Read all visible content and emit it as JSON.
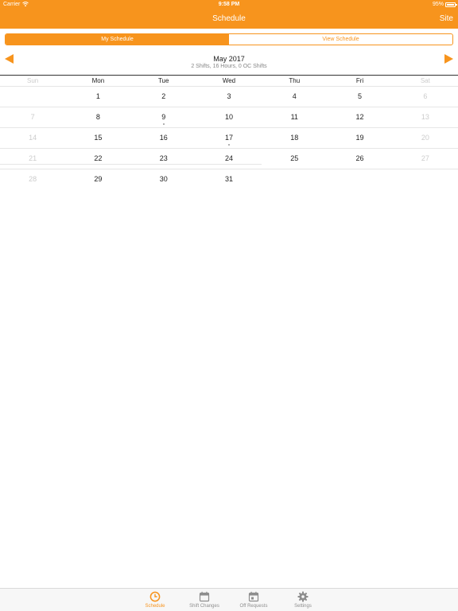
{
  "status_bar": {
    "carrier": "Carrier",
    "time": "9:58 PM",
    "battery": "95%"
  },
  "nav": {
    "title": "Schedule",
    "right_button": "Site"
  },
  "segments": [
    {
      "label": "My Schedule",
      "active": true
    },
    {
      "label": "View Schedule",
      "active": false
    }
  ],
  "month": {
    "title": "May 2017",
    "summary": "2 Shifts, 16 Hours, 0 OC Shifts"
  },
  "weekdays": [
    "Sun",
    "Mon",
    "Tue",
    "Wed",
    "Thu",
    "Fri",
    "Sat"
  ],
  "weeks": [
    [
      "",
      "1",
      "2",
      "3",
      "4",
      "5",
      "6"
    ],
    [
      "7",
      "8",
      "9",
      "10",
      "11",
      "12",
      "13"
    ],
    [
      "14",
      "15",
      "16",
      "17",
      "18",
      "19",
      "20"
    ],
    [
      "21",
      "22",
      "23",
      "24",
      "25",
      "26",
      "27"
    ],
    [
      "28",
      "29",
      "30",
      "31",
      "",
      "",
      ""
    ]
  ],
  "shift_days": [
    "9",
    "17"
  ],
  "tabs": [
    {
      "label": "Schedule",
      "icon": "clock-icon",
      "active": true
    },
    {
      "label": "Shift Changes",
      "icon": "calendar-icon",
      "active": false
    },
    {
      "label": "Off Requests",
      "icon": "calendar-off-icon",
      "active": false
    },
    {
      "label": "Settings",
      "icon": "gear-icon",
      "active": false
    }
  ],
  "colors": {
    "accent": "#f7941d",
    "inactive": "#8e8e8e",
    "weekend": "#cccccc"
  }
}
